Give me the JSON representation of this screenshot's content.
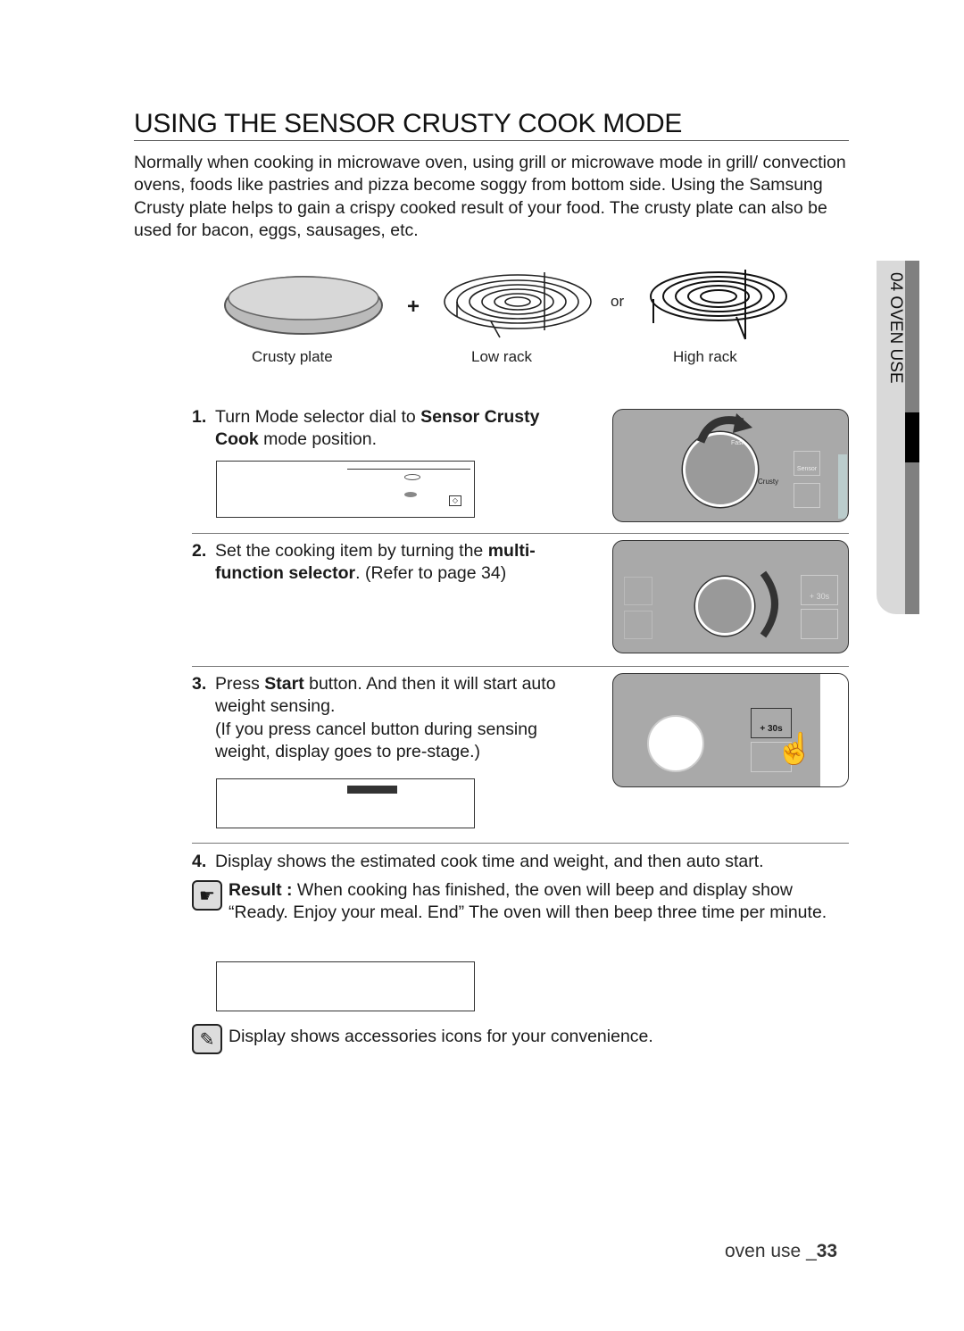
{
  "title": "USING THE SENSOR CRUSTY COOK MODE",
  "intro": "Normally when cooking in microwave oven, using grill or microwave mode in grill/ convection ovens, foods like pastries and pizza become soggy from bottom side. Using the Samsung Crusty plate helps to gain a crispy cooked result of your food. The crusty plate can also be used for bacon, eggs, sausages, etc.",
  "accessories": {
    "plus": "+",
    "or": "or",
    "crusty_plate": "Crusty plate",
    "low_rack": "Low rack",
    "high_rack": "High rack"
  },
  "steps": [
    {
      "num": "1.",
      "pre": "Turn Mode selector dial to ",
      "bold": "Sensor Crusty Cook",
      "post": " mode position."
    },
    {
      "num": "2.",
      "pre": "Set the cooking item by turning the ",
      "bold": "multi-function selector",
      "post": ". (Refer to page 34)"
    },
    {
      "num": "3.",
      "pre": "Press ",
      "bold": "Start",
      "post": " button. And then it will start auto weight sensing.",
      "note": "(If you press cancel button during sensing weight, display goes to pre-stage.)"
    },
    {
      "num": "4.",
      "text": "Display shows the estimated cook time and weight, and then auto start."
    }
  ],
  "panel_labels": {
    "crusty": "Crusty",
    "sensor": "Sensor",
    "plus30": "+ 30s",
    "fast": "Fast"
  },
  "result": {
    "label": "Result :",
    "text": " When cooking has finished, the oven will beep and display show “Ready. Enjoy your meal. End” The oven will then beep three time per minute."
  },
  "note": "Display shows accessories icons for your convenience.",
  "side_tab": "04 OVEN USE",
  "footer": {
    "label": "oven use _",
    "page": "33"
  }
}
